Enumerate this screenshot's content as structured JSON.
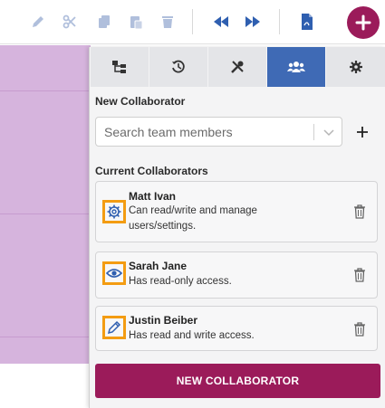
{
  "toolbar": {
    "buttons": [
      {
        "icon": "pencil-icon"
      },
      {
        "icon": "scissors-icon"
      },
      {
        "icon": "copy-icon"
      },
      {
        "icon": "paste-icon"
      },
      {
        "icon": "trash-icon"
      },
      {
        "icon": "rewind-icon"
      },
      {
        "icon": "fast-forward-icon"
      },
      {
        "icon": "pdf-icon"
      }
    ],
    "add_icon": "plus-icon",
    "colors": {
      "muted_icon": "#b0bfdc",
      "active_icon": "#2f5fb0",
      "fab": "#9b1b5a"
    }
  },
  "panel": {
    "tabs": [
      {
        "icon": "hierarchy-icon",
        "active": false
      },
      {
        "icon": "history-icon",
        "active": false
      },
      {
        "icon": "tools-icon",
        "active": false
      },
      {
        "icon": "users-icon",
        "active": true
      },
      {
        "icon": "gear-icon",
        "active": false
      }
    ],
    "new_collaborator_label": "New Collaborator",
    "search_placeholder": "Search team members",
    "current_collaborators_label": "Current Collaborators",
    "collaborators": [
      {
        "name": "Matt Ivan",
        "description": "Can read/write and manage users/settings.",
        "role_icon": "gear-icon"
      },
      {
        "name": "Sarah Jane",
        "description": "Has read-only access.",
        "role_icon": "eye-icon"
      },
      {
        "name": "Justin Beiber",
        "description": "Has read and write access.",
        "role_icon": "pencil-icon"
      }
    ],
    "new_button_label": "NEW COLLABORATOR",
    "colors": {
      "tab_active": "#3f6ab5",
      "highlight": "#f39c12",
      "button": "#9b1b5a"
    }
  }
}
